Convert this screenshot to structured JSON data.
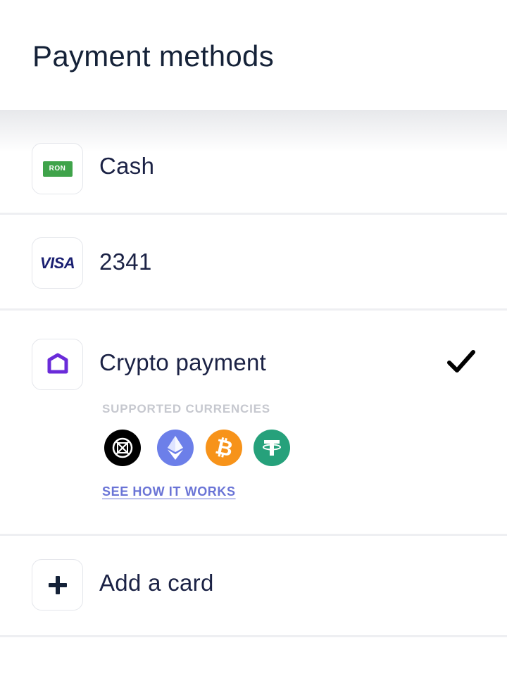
{
  "header": {
    "title": "Payment methods"
  },
  "methods": [
    {
      "label": "Cash",
      "icon": "ron-banknote-icon",
      "badge_text": "RON"
    },
    {
      "label": "2341",
      "icon": "visa-logo-icon",
      "badge_text": "VISA"
    },
    {
      "label": "Crypto payment",
      "icon": "crypto-hexagon-icon",
      "selected": true,
      "supported_label": "SUPPORTED CURRENCIES",
      "currencies": [
        {
          "name": "elrond-icon",
          "color": "#000000"
        },
        {
          "name": "ethereum-icon",
          "color": "#6c7fe9"
        },
        {
          "name": "bitcoin-icon",
          "color": "#f7931a"
        },
        {
          "name": "tether-icon",
          "color": "#26a17b"
        }
      ],
      "link_text": "SEE HOW IT WORKS"
    },
    {
      "label": "Add a card",
      "icon": "plus-icon"
    }
  ],
  "colors": {
    "text": "#1b2245",
    "link": "#6a74d6",
    "muted": "#c6c8cf",
    "cash_green": "#3fa34a",
    "visa_blue": "#1a1f71",
    "crypto_purple": "#6a2bd9"
  }
}
